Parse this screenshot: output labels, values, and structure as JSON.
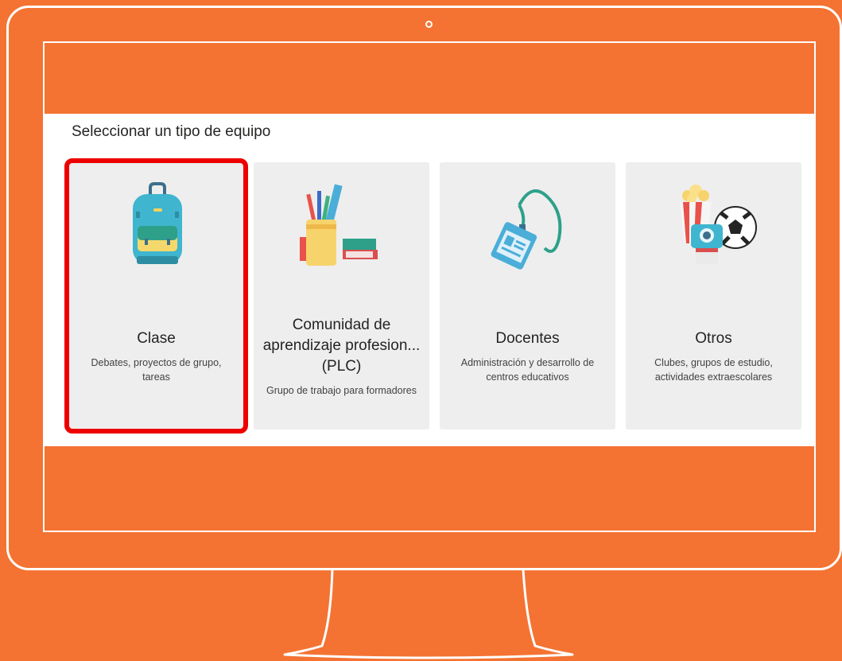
{
  "page": {
    "heading": "Seleccionar un tipo de equipo"
  },
  "team_types": [
    {
      "title": "Clase",
      "description": "Debates, proyectos de grupo, tareas",
      "selected": true
    },
    {
      "title": "Comunidad de aprendizaje profesion... (PLC)",
      "description": "Grupo de trabajo para formadores",
      "selected": false
    },
    {
      "title": "Docentes",
      "description": "Administración y desarrollo de centros educativos",
      "selected": false
    },
    {
      "title": "Otros",
      "description": "Clubes, grupos de estudio, actividades extraescolares",
      "selected": false
    }
  ],
  "colors": {
    "background": "#f47333",
    "highlight": "#ee0000",
    "card": "#eeeeee"
  },
  "icons": [
    "backpack-icon",
    "pencil-cup-icon",
    "id-badge-icon",
    "popcorn-camera-ball-icon"
  ]
}
